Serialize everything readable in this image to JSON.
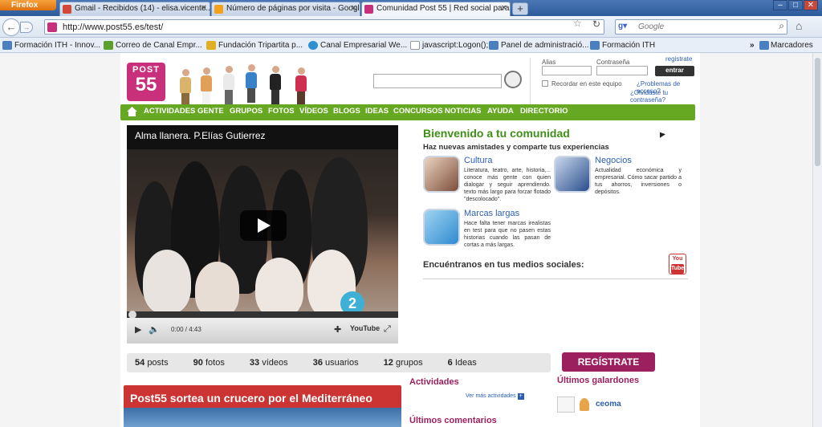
{
  "browser": {
    "app_button": "Firefox",
    "tabs": [
      {
        "label": "Gmail - Recibidos (14) - elisa.vicente..."
      },
      {
        "label": "Número de páginas por visita - Googl..."
      },
      {
        "label": "Comunidad Post 55 | Red social para ..."
      }
    ],
    "new_tab": "+",
    "url": "http://www.post55.es/test/",
    "search_engine": "Google",
    "search_placeholder": "Google",
    "bookmarks": [
      "Formación ITH - Innov...",
      "Correo de Canal Empr...",
      "Fundación Tripartita p...",
      "Canal Empresarial We...",
      "javascript:Logon();",
      "Panel de administració...",
      "Formación ITH"
    ],
    "bookmarks_menu": "Marcadores"
  },
  "site": {
    "logo_top": "POST",
    "logo_num": "55",
    "login": {
      "user_label": "Alias",
      "pass_label": "Contraseña",
      "register_link": "registrate",
      "submit": "entrar",
      "remember": "Recordar en este equipo",
      "access_problems": "¿Problemas de acceso?",
      "forgot": "¿Olvidaste tu contraseña?"
    },
    "menu": [
      "ACTIVIDADES",
      "GENTE",
      "GRUPOS",
      "FOTOS",
      "VÍDEOS",
      "BLOGS",
      "IDEAS",
      "CONCURSOS",
      "NOTICIAS",
      "AYUDA",
      "DIRECTORIO"
    ],
    "video": {
      "title": "Alma llanera. P.Elías Gutierrez",
      "time": "0:00 / 4:43",
      "brand": "YouTube",
      "channel_logo": "2",
      "progress_fraction": 0
    },
    "welcome": {
      "title": "Bienvenido a tu comunidad",
      "subtitle": "Haz nuevas amistades y comparte tus experiencias"
    },
    "features": [
      {
        "title": "Cultura",
        "text": "Literatura, teatro, arte, historia,... conoce más gente con quien dialogar y seguir aprendiendo. texto más largo para forzar flotado \"descolocado\"."
      },
      {
        "title": "Negocios",
        "text": "Actualidad económica y empresarial. Cómo sacar partido a tus ahorros, inversiones o depósitos."
      },
      {
        "title": "Marcas largas",
        "text": "Hace falta tener marcas irealistas en test para que no pasen estas historias cuando las pasan de cortas a más largas."
      }
    ],
    "social_label": "Encuéntranos en tus medios sociales:",
    "youtube_badge": {
      "top": "You",
      "bottom": "Tube"
    },
    "stats": [
      {
        "num": "54",
        "label": "posts"
      },
      {
        "num": "90",
        "label": "fotos"
      },
      {
        "num": "33",
        "label": "vídeos"
      },
      {
        "num": "36",
        "label": "usuarios"
      },
      {
        "num": "12",
        "label": "grupos"
      },
      {
        "num": "6",
        "label": "Ideas"
      }
    ],
    "register_button": "REGÍSTRATE",
    "banner_text": "Post55 sortea un crucero por el Mediterráneo",
    "activities_heading": "Actividades",
    "activities_more": "Ver más actividades",
    "comments_heading": "Últimos comentarios",
    "awards_heading": "Últimos galardones",
    "award_user": "ceoma"
  },
  "colors": {
    "brand_magenta": "#c9307c",
    "menu_green": "#66a822",
    "welcome_green": "#3f8f17",
    "link_blue": "#2b5fb4"
  }
}
